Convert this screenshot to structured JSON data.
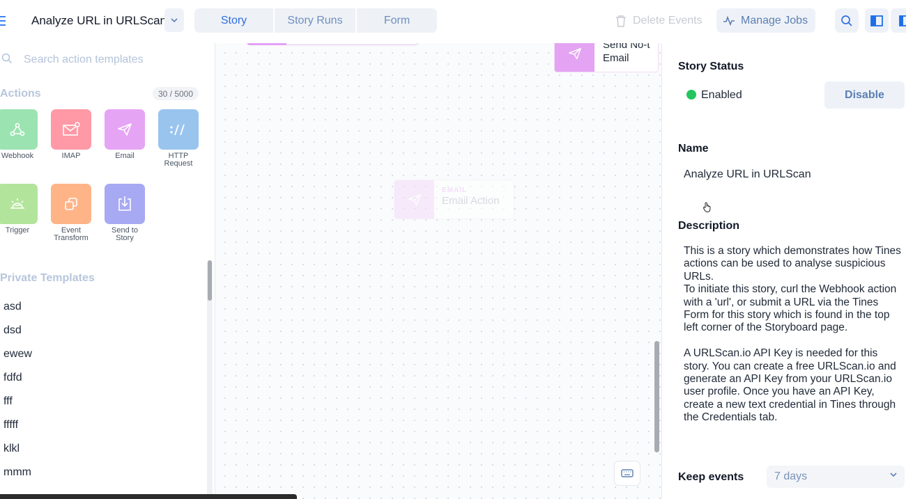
{
  "header": {
    "story_title": "Analyze URL in URLScan",
    "tabs": [
      {
        "label": "Story",
        "active": true
      },
      {
        "label": "Story Runs",
        "active": false
      },
      {
        "label": "Form",
        "active": false
      }
    ],
    "delete_events_label": "Delete Events",
    "manage_jobs_label": "Manage Jobs",
    "icons": [
      "menu-icon",
      "chevron-down-icon",
      "trash-icon",
      "activity-icon",
      "search-icon",
      "panel-left-icon",
      "panel-right-icon"
    ]
  },
  "left_panel": {
    "search_placeholder": "Search action templates",
    "actions_heading": "Actions",
    "actions_count": "30 / 5000",
    "actions": [
      {
        "label": "Webhook",
        "color": "#9be3b0",
        "icon": "webhook-icon"
      },
      {
        "label": "IMAP",
        "color": "#ff99a6",
        "icon": "mail-icon"
      },
      {
        "label": "Email",
        "color": "#e6a4f5",
        "icon": "send-icon"
      },
      {
        "label": "HTTP\nRequest",
        "color": "#99c4ee",
        "icon": "http-icon"
      },
      {
        "label": "Trigger",
        "color": "#b3e49c",
        "icon": "trigger-icon"
      },
      {
        "label": "Event\nTransform",
        "color": "#ffb488",
        "icon": "transform-icon"
      },
      {
        "label": "Send to\nStory",
        "color": "#a8a9f3",
        "icon": "send-to-story-icon"
      }
    ],
    "private_heading": "Private Templates",
    "private_templates": [
      "asd",
      "dsd",
      "ewew",
      "fdfd",
      "fff",
      "fffff",
      "klkl",
      "mmm"
    ]
  },
  "canvas": {
    "send_node_label": "Send No-t\nEmail",
    "email_node_kind": "EMAIL",
    "email_node_name": "Email Action",
    "icons": [
      "send-icon",
      "keyboard-icon"
    ]
  },
  "right_panel": {
    "story_status_heading": "Story Status",
    "status_text": "Enabled",
    "status_color": "#22c55e",
    "disable_label": "Disable",
    "name_heading": "Name",
    "name_value": "Analyze URL in URLScan",
    "description_heading": "Description",
    "description": "This is a story which demonstrates how Tines actions can be used to analyse suspicious URLs.\nTo initiate this story, curl the Webhook action with a 'url', or submit a URL via the Tines Form for this story which is found in the top left corner of the Storyboard page.\n\nA URLScan.io API Key is needed for this story. You can create a free URLScan.io and generate an API Key from your URLScan.io user profile. Once you have an API Key, create a new text credential in Tines through the Credentials tab.",
    "keep_events_heading": "Keep events",
    "keep_events_value": "7 days"
  }
}
